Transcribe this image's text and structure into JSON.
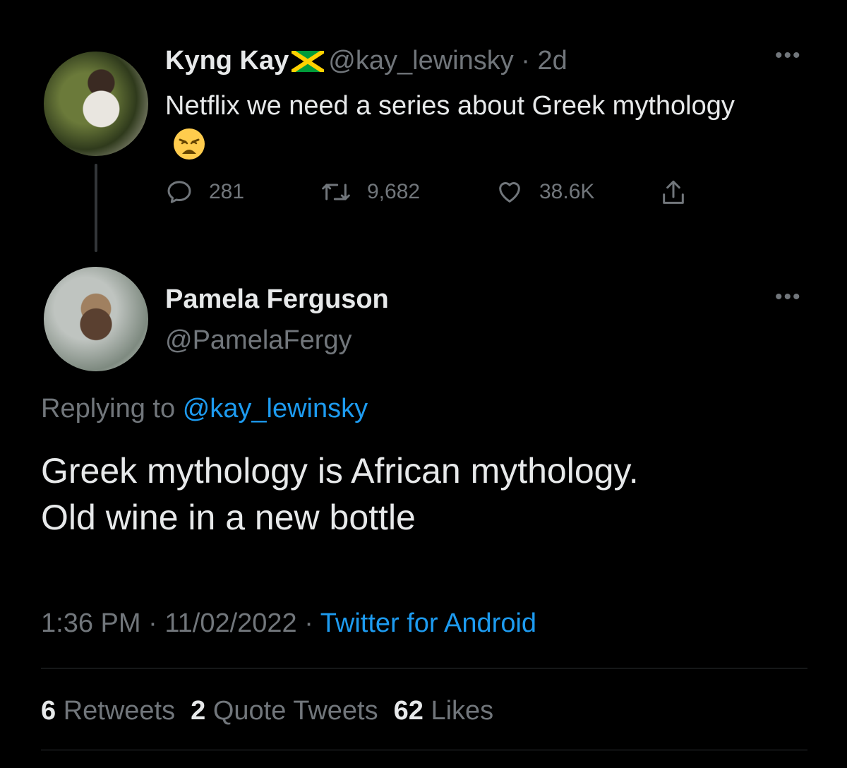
{
  "original_tweet": {
    "name": "Kyng Kay",
    "flag_icon": "jamaica-flag-icon",
    "handle": "@kay_lewinsky",
    "separator": "·",
    "time": "2d",
    "text": "Netflix we need a series about Greek mythology",
    "emoji": "😩",
    "replies": "281",
    "retweets": "9,682",
    "likes": "38.6K"
  },
  "reply_tweet": {
    "name": "Pamela Ferguson",
    "handle": "@PamelaFergy",
    "replying_prefix": "Replying to",
    "replying_mention": "@kay_lewinsky",
    "text_line_1": "Greek mythology is African mythology.",
    "text_line_2": "Old wine in a new bottle",
    "time": "1:36 PM",
    "separator": "·",
    "date": "11/02/2022",
    "source": "Twitter for Android"
  },
  "stats": {
    "retweets_count": "6",
    "retweets_label": "Retweets",
    "quotes_count": "2",
    "quotes_label": "Quote Tweets",
    "likes_count": "62",
    "likes_label": "Likes"
  },
  "colors": {
    "background": "#000000",
    "text": "#e7e9ea",
    "secondary": "#71767b",
    "link": "#1d9bf0"
  }
}
